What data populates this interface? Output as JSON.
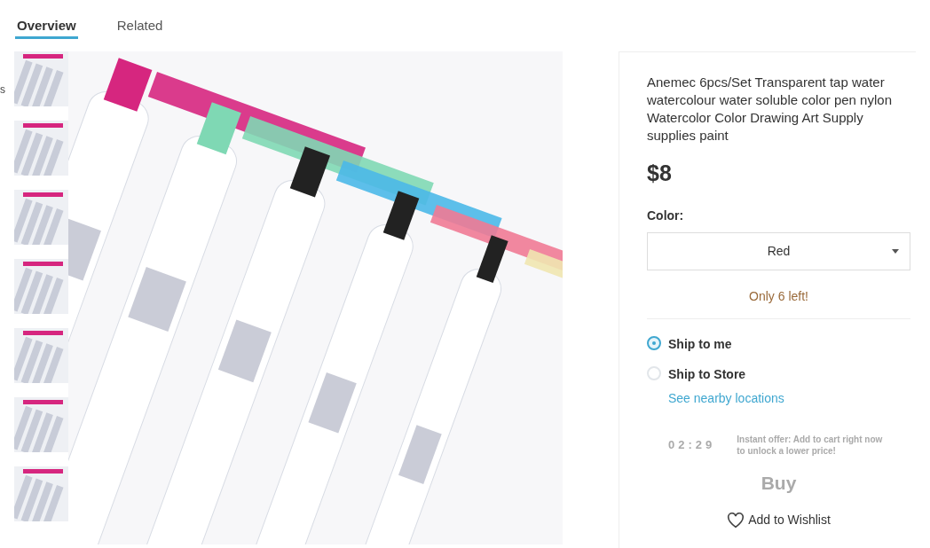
{
  "edge_text": "s",
  "tabs": [
    {
      "label": "Overview",
      "selected": true
    },
    {
      "label": "Related",
      "selected": false
    }
  ],
  "thumbnails": [
    {
      "selected": false
    },
    {
      "selected": false
    },
    {
      "selected": false
    },
    {
      "selected": false
    },
    {
      "selected": false
    },
    {
      "selected": false
    },
    {
      "selected": false
    }
  ],
  "product": {
    "title": "Anemec 6pcs/Set Transparent tap water watercolour water soluble color pen nylon Watercolor Color Drawing Art Supply supplies paint",
    "price": "$8",
    "color_label": "Color:",
    "color_value": "Red",
    "stock": "Only 6 left!"
  },
  "shipping": [
    {
      "label": "Ship to me",
      "selected": true
    },
    {
      "label": "Ship to Store",
      "selected": false,
      "link": "See nearby locations"
    }
  ],
  "offer": {
    "timer": "02:29",
    "text": "Instant offer: Add to cart right now to unlock a lower price!"
  },
  "buy_button": "Buy",
  "wishlist": "Add to Wishlist"
}
